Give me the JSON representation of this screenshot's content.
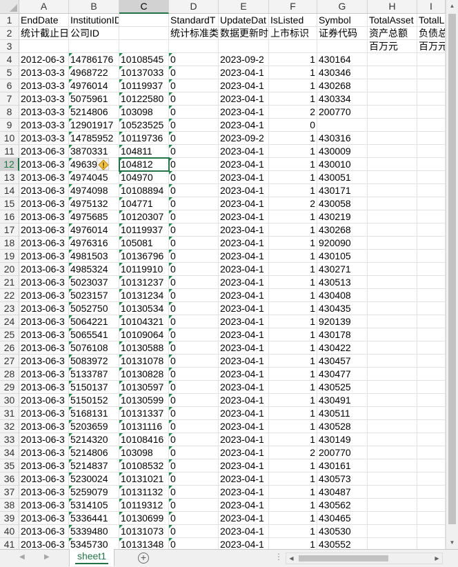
{
  "columns": [
    "A",
    "B",
    "C",
    "D",
    "E",
    "F",
    "G",
    "H",
    "I"
  ],
  "selected_col": "C",
  "selected_row": "12",
  "rows": [
    {
      "n": "1",
      "cells": [
        "EndDate",
        "InstitutionID",
        "",
        "StandardT",
        "UpdateDat",
        "IsListed",
        "Symbol",
        "TotalAsset",
        "TotalL"
      ]
    },
    {
      "n": "2",
      "cells": [
        "统计截止日",
        "公司ID",
        "",
        "统计标准类",
        "数据更新时",
        "上市标识",
        "证券代码",
        "资产总额",
        "负债总"
      ]
    },
    {
      "n": "3",
      "cells": [
        "",
        "",
        "",
        "",
        "",
        "",
        "",
        "百万元",
        "百万元"
      ]
    },
    {
      "n": "4",
      "cells": [
        "2012-06-3",
        "14786176",
        "10108545",
        "0",
        "2023-09-2",
        "1",
        "430164",
        "",
        ""
      ]
    },
    {
      "n": "5",
      "cells": [
        "2013-03-3",
        "4968722",
        "10137033",
        "0",
        "2023-04-1",
        "1",
        "430346",
        "",
        ""
      ]
    },
    {
      "n": "6",
      "cells": [
        "2013-03-3",
        "4976014",
        "10119937",
        "0",
        "2023-04-1",
        "1",
        "430268",
        "",
        ""
      ]
    },
    {
      "n": "7",
      "cells": [
        "2013-03-3",
        "5075961",
        "10122580",
        "0",
        "2023-04-1",
        "1",
        "430334",
        "",
        ""
      ]
    },
    {
      "n": "8",
      "cells": [
        "2013-03-3",
        "5214806",
        "103098",
        "0",
        "2023-04-1",
        "2",
        "200770",
        "",
        ""
      ]
    },
    {
      "n": "9",
      "cells": [
        "2013-03-3",
        "12901917",
        "10523525",
        "0",
        "2023-04-1",
        "0",
        "",
        "",
        ""
      ]
    },
    {
      "n": "10",
      "cells": [
        "2013-03-3",
        "14785952",
        "10119736",
        "0",
        "2023-09-2",
        "1",
        "430316",
        "",
        ""
      ]
    },
    {
      "n": "11",
      "cells": [
        "2013-06-3",
        "3870331",
        "104811",
        "0",
        "2023-04-1",
        "1",
        "430009",
        "",
        ""
      ]
    },
    {
      "n": "12",
      "cells": [
        "2013-06-3",
        "49639",
        "104812",
        "0",
        "2023-04-1",
        "1",
        "430010",
        "",
        ""
      ]
    },
    {
      "n": "13",
      "cells": [
        "2013-06-3",
        "4974045",
        "104970",
        "0",
        "2023-04-1",
        "1",
        "430051",
        "",
        ""
      ]
    },
    {
      "n": "14",
      "cells": [
        "2013-06-3",
        "4974098",
        "10108894",
        "0",
        "2023-04-1",
        "1",
        "430171",
        "",
        ""
      ]
    },
    {
      "n": "15",
      "cells": [
        "2013-06-3",
        "4975132",
        "104771",
        "0",
        "2023-04-1",
        "2",
        "430058",
        "",
        ""
      ]
    },
    {
      "n": "16",
      "cells": [
        "2013-06-3",
        "4975685",
        "10120307",
        "0",
        "2023-04-1",
        "1",
        "430219",
        "",
        ""
      ]
    },
    {
      "n": "17",
      "cells": [
        "2013-06-3",
        "4976014",
        "10119937",
        "0",
        "2023-04-1",
        "1",
        "430268",
        "",
        ""
      ]
    },
    {
      "n": "18",
      "cells": [
        "2013-06-3",
        "4976316",
        "105081",
        "0",
        "2023-04-1",
        "1",
        "920090",
        "",
        ""
      ]
    },
    {
      "n": "19",
      "cells": [
        "2013-06-3",
        "4981503",
        "10136796",
        "0",
        "2023-04-1",
        "1",
        "430105",
        "",
        ""
      ]
    },
    {
      "n": "20",
      "cells": [
        "2013-06-3",
        "4985324",
        "10119910",
        "0",
        "2023-04-1",
        "1",
        "430271",
        "",
        ""
      ]
    },
    {
      "n": "21",
      "cells": [
        "2013-06-3",
        "5023037",
        "10131237",
        "0",
        "2023-04-1",
        "1",
        "430513",
        "",
        ""
      ]
    },
    {
      "n": "22",
      "cells": [
        "2013-06-3",
        "5023157",
        "10131234",
        "0",
        "2023-04-1",
        "1",
        "430408",
        "",
        ""
      ]
    },
    {
      "n": "23",
      "cells": [
        "2013-06-3",
        "5052750",
        "10130534",
        "0",
        "2023-04-1",
        "1",
        "430435",
        "",
        ""
      ]
    },
    {
      "n": "24",
      "cells": [
        "2013-06-3",
        "5064221",
        "10104321",
        "0",
        "2023-04-1",
        "1",
        "920139",
        "",
        ""
      ]
    },
    {
      "n": "25",
      "cells": [
        "2013-06-3",
        "5065541",
        "10109064",
        "0",
        "2023-04-1",
        "1",
        "430178",
        "",
        ""
      ]
    },
    {
      "n": "26",
      "cells": [
        "2013-06-3",
        "5076108",
        "10130588",
        "0",
        "2023-04-1",
        "1",
        "430422",
        "",
        ""
      ]
    },
    {
      "n": "27",
      "cells": [
        "2013-06-3",
        "5083972",
        "10131078",
        "0",
        "2023-04-1",
        "1",
        "430457",
        "",
        ""
      ]
    },
    {
      "n": "28",
      "cells": [
        "2013-06-3",
        "5133787",
        "10130828",
        "0",
        "2023-04-1",
        "1",
        "430477",
        "",
        ""
      ]
    },
    {
      "n": "29",
      "cells": [
        "2013-06-3",
        "5150137",
        "10130597",
        "0",
        "2023-04-1",
        "1",
        "430525",
        "",
        ""
      ]
    },
    {
      "n": "30",
      "cells": [
        "2013-06-3",
        "5150152",
        "10130599",
        "0",
        "2023-04-1",
        "1",
        "430491",
        "",
        ""
      ]
    },
    {
      "n": "31",
      "cells": [
        "2013-06-3",
        "5168131",
        "10131337",
        "0",
        "2023-04-1",
        "1",
        "430511",
        "",
        ""
      ]
    },
    {
      "n": "32",
      "cells": [
        "2013-06-3",
        "5203659",
        "10131116",
        "0",
        "2023-04-1",
        "1",
        "430528",
        "",
        ""
      ]
    },
    {
      "n": "33",
      "cells": [
        "2013-06-3",
        "5214320",
        "10108416",
        "0",
        "2023-04-1",
        "1",
        "430149",
        "",
        ""
      ]
    },
    {
      "n": "34",
      "cells": [
        "2013-06-3",
        "5214806",
        "103098",
        "0",
        "2023-04-1",
        "2",
        "200770",
        "",
        ""
      ]
    },
    {
      "n": "35",
      "cells": [
        "2013-06-3",
        "5214837",
        "10108532",
        "0",
        "2023-04-1",
        "1",
        "430161",
        "",
        ""
      ]
    },
    {
      "n": "36",
      "cells": [
        "2013-06-3",
        "5230024",
        "10131021",
        "0",
        "2023-04-1",
        "1",
        "430573",
        "",
        ""
      ]
    },
    {
      "n": "37",
      "cells": [
        "2013-06-3",
        "5259079",
        "10131132",
        "0",
        "2023-04-1",
        "1",
        "430487",
        "",
        ""
      ]
    },
    {
      "n": "38",
      "cells": [
        "2013-06-3",
        "5314105",
        "10119312",
        "0",
        "2023-04-1",
        "1",
        "430562",
        "",
        ""
      ]
    },
    {
      "n": "39",
      "cells": [
        "2013-06-3",
        "5336441",
        "10130699",
        "0",
        "2023-04-1",
        "1",
        "430465",
        "",
        ""
      ]
    },
    {
      "n": "40",
      "cells": [
        "2013-06-3",
        "5339480",
        "10131073",
        "0",
        "2023-04-1",
        "1",
        "430530",
        "",
        ""
      ]
    },
    {
      "n": "41",
      "cells": [
        "2013-06-3",
        "5345730",
        "10131348",
        "0",
        "2023-04-1",
        "1",
        "430552",
        "",
        ""
      ]
    }
  ],
  "sheet_tab": "sheet1",
  "add_sheet_symbol": "+",
  "more_symbol": "⋮",
  "icons": {
    "warning": "warning-diamond-icon",
    "add": "add-sheet-icon"
  },
  "colors": {
    "accent": "#217346",
    "tri": "#1e8a4a"
  }
}
